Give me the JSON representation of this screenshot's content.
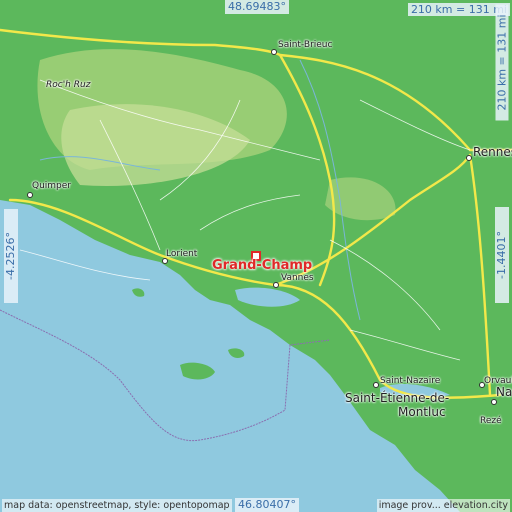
{
  "map": {
    "coords": {
      "top": "48.69483°",
      "bottom": "46.80407°",
      "left": "-4.2526°",
      "right": "-1.4401°"
    },
    "scale": {
      "horizontal": "210 km = 131 mi",
      "vertical": "210 km = 131 mi"
    },
    "highlight": "Grand-Champ",
    "places": {
      "saint_brieuc": "Saint-Brieuc",
      "rennes": "Rennes",
      "quimper": "Quimper",
      "lorient": "Lorient",
      "vannes": "Vannes",
      "saint_nazaire": "Saint-Nazaire",
      "saint_etienne_l1": "Saint-Étienne-de-",
      "saint_etienne_l2": "Montluc",
      "orvault": "Orvault",
      "nantes": "Na",
      "reze": "Rezé",
      "roc_h_ruz": "Roc'h Ruz"
    },
    "credits": {
      "left": "map data: openstreetmap, style: opentopomap",
      "right": "image prov... elevation.city"
    },
    "colors": {
      "sea": "#8fc9df",
      "land": "#5cb85c",
      "highland": "#b7d98a",
      "road": "#f2e84a",
      "highlight": "#e02828"
    }
  }
}
